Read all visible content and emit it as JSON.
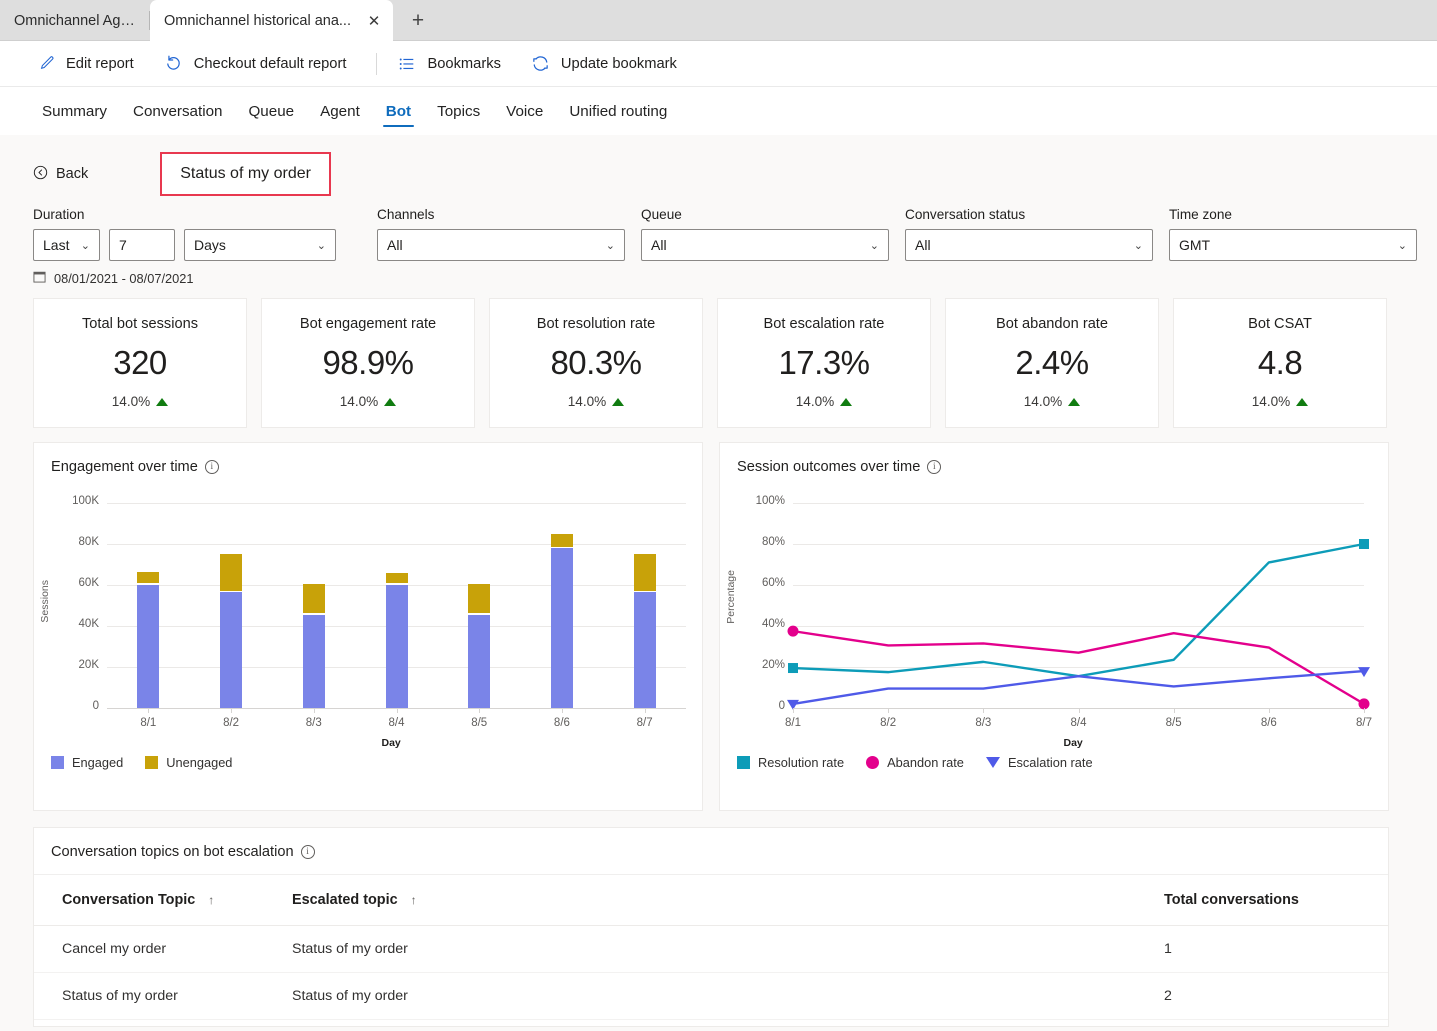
{
  "browser": {
    "tabs": [
      {
        "title": "Omnichannel Agent",
        "active": false
      },
      {
        "title": "Omnichannel historical ana...",
        "active": true
      }
    ],
    "close_glyph": "✕",
    "newtab_glyph": "+"
  },
  "commandbar": {
    "items": [
      {
        "label": "Edit report",
        "icon": "pencil-icon"
      },
      {
        "label": "Checkout default report",
        "icon": "undo-icon"
      },
      {
        "label": "Bookmarks",
        "icon": "list-icon"
      },
      {
        "label": "Update bookmark",
        "icon": "refresh-icon"
      }
    ]
  },
  "navtabs": [
    {
      "label": "Summary",
      "selected": false
    },
    {
      "label": "Conversation",
      "selected": false
    },
    {
      "label": "Queue",
      "selected": false
    },
    {
      "label": "Agent",
      "selected": false
    },
    {
      "label": "Bot",
      "selected": true
    },
    {
      "label": "Topics",
      "selected": false
    },
    {
      "label": "Voice",
      "selected": false
    },
    {
      "label": "Unified routing",
      "selected": false
    }
  ],
  "header": {
    "back_label": "Back",
    "back_icon": "back-circle-icon",
    "page_title": "Status of my order",
    "highlight_color": "#e8384f"
  },
  "filters": {
    "duration": {
      "label": "Duration",
      "relative": "Last",
      "amount": "7",
      "unit": "Days"
    },
    "channels": {
      "label": "Channels",
      "value": "All"
    },
    "queue": {
      "label": "Queue",
      "value": "All"
    },
    "conversation_status": {
      "label": "Conversation status",
      "value": "All"
    },
    "time_zone": {
      "label": "Time zone",
      "value": "GMT"
    },
    "date_range": "08/01/2021 - 08/07/2021",
    "calendar_icon": "calendar-icon"
  },
  "kpis": [
    {
      "title": "Total bot sessions",
      "value": "320",
      "delta": "14.0%",
      "trend": "up"
    },
    {
      "title": "Bot engagement rate",
      "value": "98.9%",
      "delta": "14.0%",
      "trend": "up"
    },
    {
      "title": "Bot resolution rate",
      "value": "80.3%",
      "delta": "14.0%",
      "trend": "up"
    },
    {
      "title": "Bot escalation rate",
      "value": "17.3%",
      "delta": "14.0%",
      "trend": "up"
    },
    {
      "title": "Bot abandon rate",
      "value": "2.4%",
      "delta": "14.0%",
      "trend": "up"
    },
    {
      "title": "Bot CSAT",
      "value": "4.8",
      "delta": "14.0%",
      "trend": "up"
    }
  ],
  "panels": {
    "engagement_title": "Engagement over time",
    "outcomes_title": "Session outcomes over time",
    "table_title": "Conversation topics on bot escalation"
  },
  "chart_data": [
    {
      "type": "bar",
      "title": "Engagement over time",
      "stacked": true,
      "categories": [
        "8/1",
        "8/2",
        "8/3",
        "8/4",
        "8/5",
        "8/6",
        "8/7"
      ],
      "series": [
        {
          "name": "Engaged",
          "color": "#7a84e8",
          "values": [
            60000,
            56500,
            45500,
            60000,
            45500,
            78000,
            56500
          ]
        },
        {
          "name": "Unengaged",
          "color": "#c8a209",
          "values": [
            6500,
            18500,
            15000,
            6000,
            15000,
            7000,
            18500
          ]
        }
      ],
      "xlabel": "Day",
      "ylabel": "Sessions",
      "ylim": [
        0,
        100000
      ],
      "yticks": [
        "0",
        "20K",
        "40K",
        "60K",
        "80K",
        "100K"
      ],
      "grid": true,
      "legend_position": "bottom"
    },
    {
      "type": "line",
      "title": "Session outcomes over time",
      "x": [
        "8/1",
        "8/2",
        "8/3",
        "8/4",
        "8/5",
        "8/6",
        "8/7"
      ],
      "series": [
        {
          "name": "Resolution rate",
          "color": "#0d9cb8",
          "marker": "square",
          "values": [
            19.5,
            17.5,
            22.5,
            15.5,
            23.5,
            71.0,
            80.0
          ]
        },
        {
          "name": "Abandon rate",
          "color": "#e3008c",
          "marker": "circle",
          "values": [
            37.5,
            30.5,
            31.5,
            27.0,
            36.5,
            29.5,
            2.0
          ]
        },
        {
          "name": "Escalation rate",
          "color": "#4f5ae8",
          "marker": "triangle",
          "values": [
            2.0,
            9.5,
            9.5,
            15.5,
            10.5,
            14.5,
            18.0
          ]
        }
      ],
      "xlabel": "Day",
      "ylabel": "Percentage",
      "ylim": [
        0,
        100
      ],
      "yticks": [
        "0",
        "20%",
        "40%",
        "60%",
        "80%",
        "100%"
      ],
      "grid": true,
      "legend_position": "bottom"
    }
  ],
  "table": {
    "columns": [
      {
        "label": "Conversation Topic",
        "sort": "↑"
      },
      {
        "label": "Escalated topic",
        "sort": "↑"
      },
      {
        "label": "Total conversations",
        "sort": ""
      }
    ],
    "rows": [
      {
        "topic": "Cancel my order",
        "escalated": "Status of my order",
        "total": "1"
      },
      {
        "topic": "Status of my order",
        "escalated": "Status of my order",
        "total": "2"
      }
    ]
  }
}
